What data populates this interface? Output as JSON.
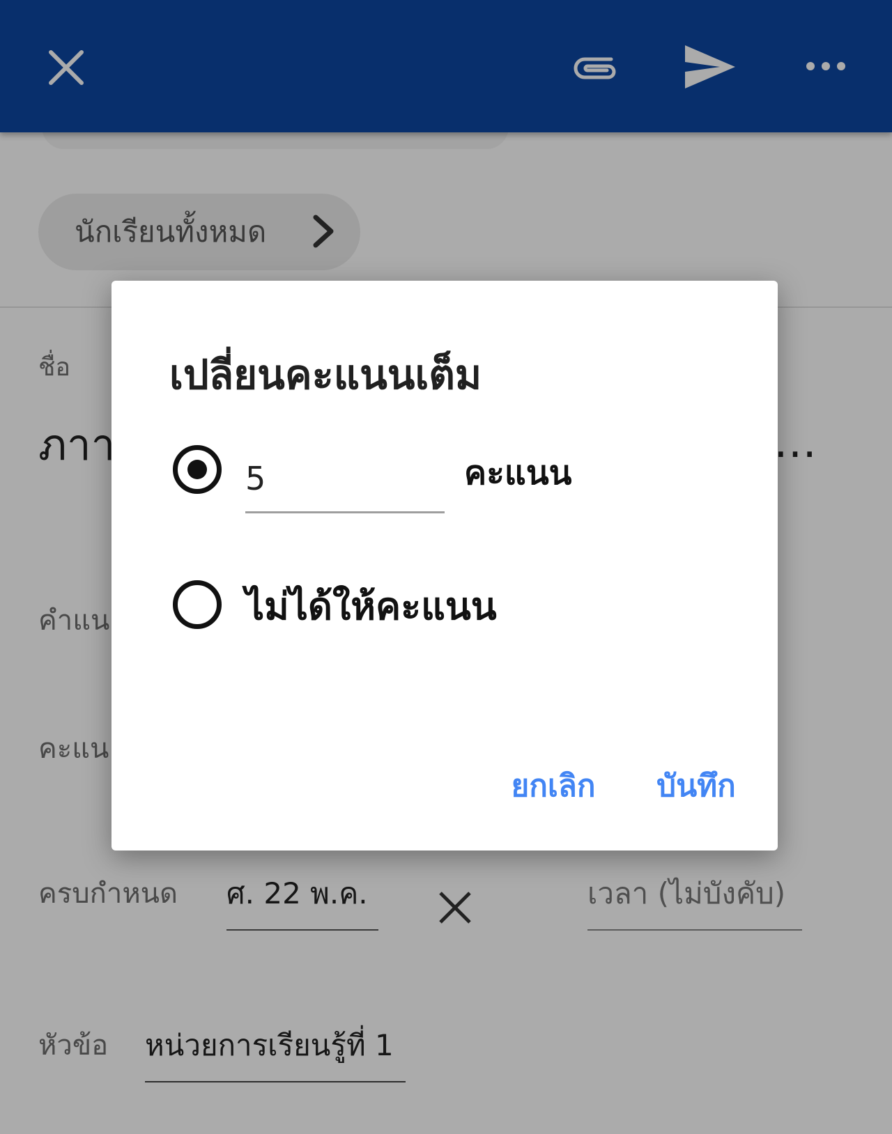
{
  "appbar": {
    "close_icon": "close-icon",
    "attach_icon": "paperclip-icon",
    "send_icon": "send-icon",
    "more_icon": "more-horizontal-icon",
    "color": "#0d47a1"
  },
  "page": {
    "students_chip_label": "นักเรียนทั้งหมด",
    "title_label": "ชื่อ",
    "title_value": "ภาา",
    "title_ellipsis": "…",
    "instructions_label": "คำแน",
    "points_label": "คะแน",
    "due_label": "ครบกำหนด",
    "due_value": "ศ. 22 พ.ค.",
    "time_placeholder": "เวลา (ไม่บังคับ)",
    "topic_label": "หัวข้อ",
    "topic_value": "หน่วยการเรียนรู้ที่ 1"
  },
  "dialog": {
    "title": "เปลี่ยนคะแนนเต็ม",
    "points_value": "5",
    "points_unit": "คะแนน",
    "ungraded_label": "ไม่ได้ให้คะแนน",
    "selected_option": "points",
    "cancel_label": "ยกเลิก",
    "save_label": "บันทึก",
    "accent_color": "#4285f4"
  }
}
